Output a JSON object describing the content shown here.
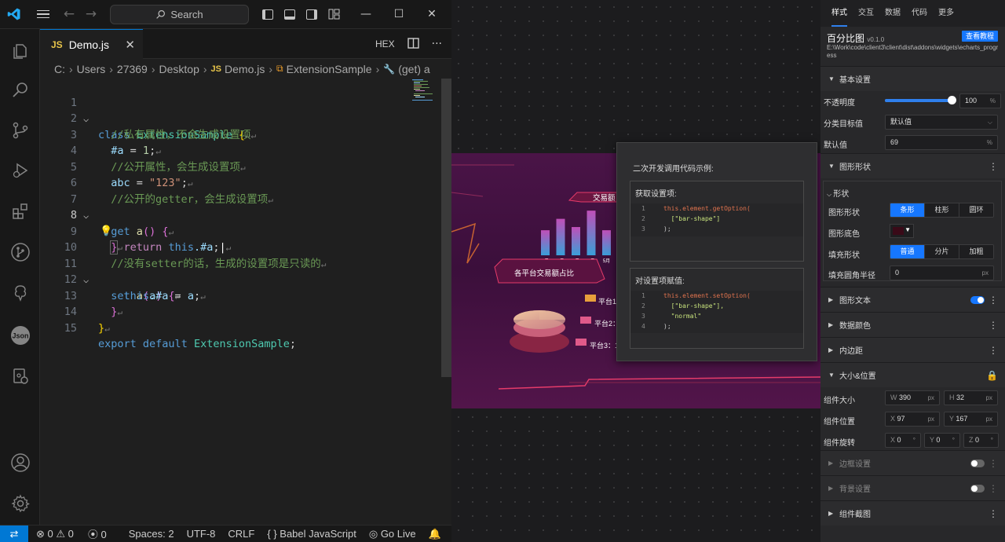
{
  "vscode": {
    "search_label": "Search",
    "tab": {
      "lang": "JS",
      "name": "Demo.js"
    },
    "tab_actions": {
      "hex": "HEX"
    },
    "breadcrumb": [
      "C:",
      "Users",
      "27369",
      "Desktop",
      "Demo.js",
      "ExtensionSample",
      "(get) a"
    ],
    "breadcrumb_lang": "JS",
    "line_numbers": [
      "1",
      "2",
      "3",
      "4",
      "5",
      "6",
      "7",
      "8",
      "9",
      "10",
      "11",
      "12",
      "13",
      "14",
      "15"
    ],
    "current_line": "8",
    "statusbar": {
      "errors": "0",
      "warnings": "0",
      "ports": "0",
      "spaces": "Spaces: 2",
      "encoding": "UTF-8",
      "eol": "CRLF",
      "language": "Babel JavaScript",
      "golive": "Go Live"
    }
  },
  "code": {
    "l1": {
      "kw": "class",
      "name": "ExtensionSample",
      "tail": " {"
    },
    "l2": "//私有属性，不会生成设置项",
    "l3": {
      "name": "#a",
      "op": " = ",
      "num": "1",
      "tail": ";"
    },
    "l4": "//公开属性，会生成设置项",
    "l5": {
      "name": "abc",
      "op": " = ",
      "str": "\"123\"",
      "tail": ";"
    },
    "l6": "//公开的getter，会生成设置项",
    "l7": {
      "kw": "get",
      "fn": "a",
      "paren": "()",
      "tail": " {"
    },
    "l8": {
      "ret": "return",
      "this": "this",
      "prop": ".#a",
      "tail": ";"
    },
    "l9": "}",
    "l10": "//没有setter的话，生成的设置项是只读的",
    "l11": {
      "kw": "set",
      "fn": "a",
      "paren_open": "(",
      "arg": "a",
      "paren_close": ")",
      "tail": " {"
    },
    "l12": {
      "this": "this",
      "prop": ".#a",
      "op": " = ",
      "arg": "a",
      "tail": ";"
    },
    "l13": "}",
    "l14": "}",
    "l15": {
      "kw1": "export",
      "kw2": "default",
      "name": "ExtensionSample",
      "tail": ";"
    }
  },
  "dashboard": {
    "title1": "交易额",
    "title2": "各平台交易额占比",
    "months": [
      "1月",
      "2月",
      "3月",
      "4月",
      "5月"
    ],
    "bar_values": [
      0.55,
      0.8,
      0.62,
      0.98,
      0.55
    ],
    "platforms": [
      "平台1",
      "平台2：",
      "平台3：1"
    ]
  },
  "popup": {
    "title": "二次开发调用代码示例:",
    "get_label": "获取设置项:",
    "get_code": [
      {
        "n": "1",
        "obj": "this",
        "method": ".element.getOption(",
        "arg": ""
      },
      {
        "n": "2",
        "obj": "",
        "method": "",
        "arg": "  [\"bar-shape\"]"
      },
      {
        "n": "3",
        "obj": "",
        "method": "",
        "arg": ");"
      }
    ],
    "set_label": "对设置项赋值:",
    "set_code": [
      {
        "n": "1",
        "obj": "this",
        "method": ".element.setOption(",
        "arg": ""
      },
      {
        "n": "2",
        "obj": "",
        "method": "",
        "arg": "  [\"bar-shape\"],"
      },
      {
        "n": "3",
        "obj": "",
        "method": "",
        "arg": "  \"normal\""
      },
      {
        "n": "4",
        "obj": "",
        "method": "",
        "arg": ");"
      }
    ]
  },
  "panel": {
    "tabs": [
      "样式",
      "交互",
      "数据",
      "代码",
      "更多"
    ],
    "active_tab": "样式",
    "widget_name": "百分比图",
    "version": "v0.1.0",
    "tutorial_btn": "查看教程",
    "path": "E:\\Work\\code\\client3\\client\\dist\\addons\\widgets\\echarts_progress",
    "basic": {
      "title": "基本设置",
      "opacity_label": "不透明度",
      "opacity_value": "100",
      "opacity_unit": "%",
      "opacity_level": 1.0,
      "target_label": "分类目标值",
      "target_value": "默认值",
      "default_label": "默认值",
      "default_value": "69",
      "default_unit": "%"
    },
    "shape": {
      "title": "图形形状",
      "sub": "形状",
      "shape_label": "图形形状",
      "shape_opts": [
        "条形",
        "柱形",
        "圆环"
      ],
      "base_label": "图形底色",
      "base_color": "#3a0a18",
      "fill_label": "填充形状",
      "fill_opts": [
        "普通",
        "分片",
        "加粗"
      ],
      "radius_label": "填充圆角半径",
      "radius_value": "0",
      "radius_unit": "px"
    },
    "text": {
      "title": "图形文本"
    },
    "colors": {
      "title": "数据颜色"
    },
    "padding": {
      "title": "内边距"
    },
    "size": {
      "title": "大小&位置",
      "size_label": "组件大小",
      "w_label": "W",
      "w_value": "390",
      "h_label": "H",
      "h_value": "32",
      "px": "px",
      "pos_label": "组件位置",
      "x_label": "X",
      "x_value": "97",
      "y_label": "Y",
      "y_value": "167",
      "rot_label": "组件旋转",
      "rx_label": "X",
      "rx_value": "0",
      "ry_label": "Y",
      "ry_value": "0",
      "rz_label": "Z",
      "rz_value": "0",
      "deg": "°"
    },
    "border": {
      "title": "边框设置"
    },
    "background": {
      "title": "背景设置"
    },
    "screenshot": {
      "title": "组件截图"
    }
  },
  "colors": {
    "accent": "#0078d4",
    "primary_btn": "#1677ff"
  }
}
